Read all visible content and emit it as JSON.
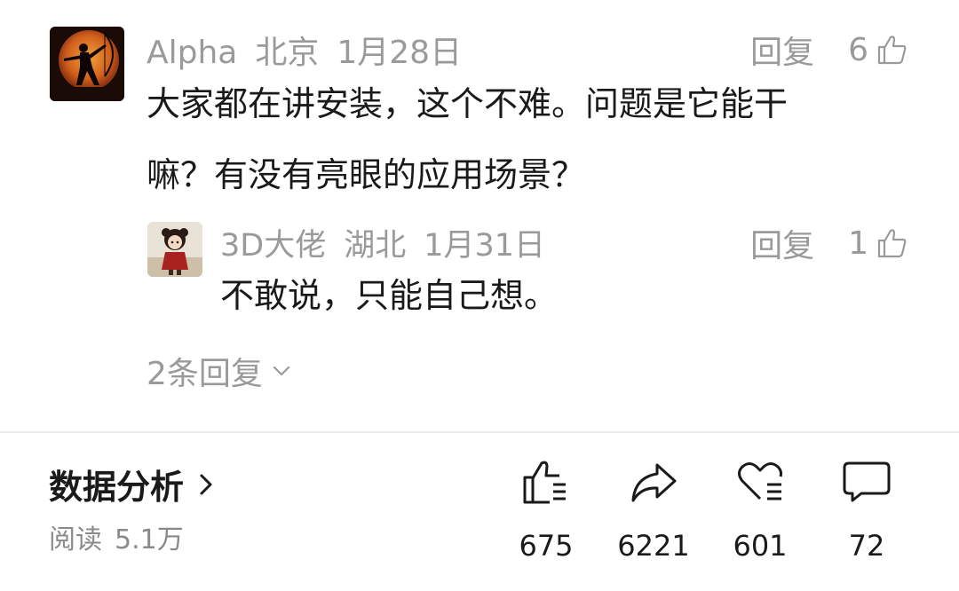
{
  "comments": {
    "main": {
      "author": "Alpha",
      "location": "北京",
      "date": "1月28日",
      "reply_label": "回复",
      "likes": "6",
      "text_line1": "大家都在讲安装，这个不难。问题是它能干",
      "text_line2": "嘛？有没有亮眼的应用场景？",
      "avatar_icon": "archer-silhouette-avatar"
    },
    "reply": {
      "author": "3D大佬",
      "location": "湖北",
      "date": "1月31日",
      "reply_label": "回复",
      "likes": "1",
      "text": "不敢说，只能自己想。",
      "avatar_icon": "cartoon-figure-avatar"
    },
    "expand_label": "2条回复"
  },
  "footer": {
    "section_title": "数据分析",
    "read_label": "阅读",
    "read_count": "5.1万",
    "stats": [
      {
        "icon": "thumbs-up-icon",
        "value": "675"
      },
      {
        "icon": "share-arrow-icon",
        "value": "6221"
      },
      {
        "icon": "heart-icon",
        "value": "601"
      },
      {
        "icon": "comment-bubble-icon",
        "value": "72"
      }
    ]
  },
  "colors": {
    "text": "#1a1a1a",
    "muted": "#9a9a9a",
    "divider": "#ececec",
    "avatar_main_bg": "#cf6a1e"
  }
}
